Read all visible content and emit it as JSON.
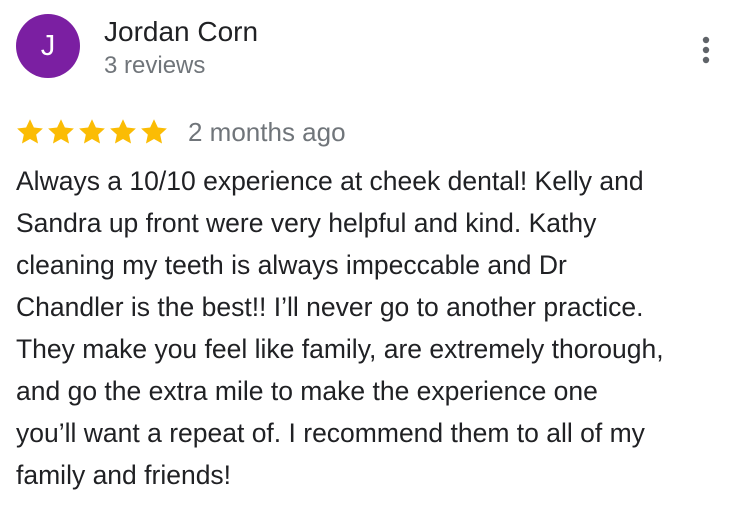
{
  "reviewer": {
    "avatar_initial": "J",
    "avatar_color": "#7b1fa2",
    "name": "Jordan Corn",
    "review_count": "3 reviews"
  },
  "menu": {
    "icon": "more-vert-icon"
  },
  "rating": {
    "stars": 5,
    "max_stars": 5,
    "star_color": "#fbbc04"
  },
  "review": {
    "date": "2 months ago",
    "lines": [
      "Always a 10/10 experience at cheek dental! Kelly and",
      "Sandra up front were very helpful and kind. Kathy",
      "cleaning my teeth is always impeccable and Dr",
      "Chandler is the best!! I’ll never go to another practice.",
      "They make you feel like family, are extremely thorough,",
      "and go the extra mile to make the experience one",
      "you’ll want a repeat of. I recommend them to all of my",
      "family and friends!"
    ]
  }
}
